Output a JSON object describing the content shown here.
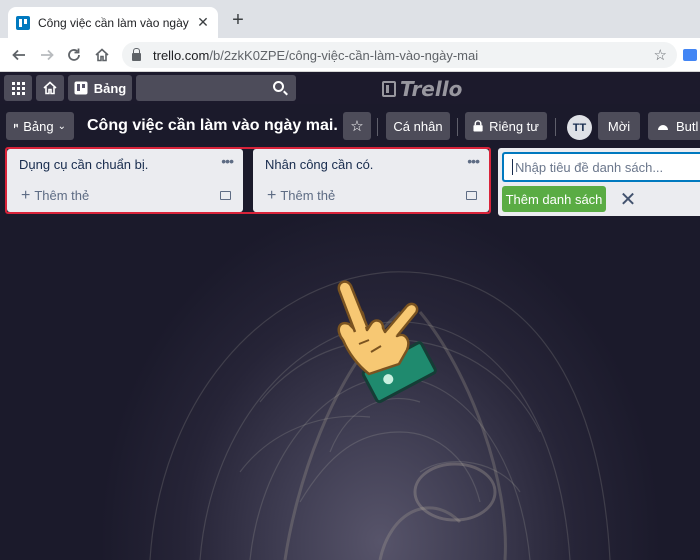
{
  "browser": {
    "tab_title": "Công việc cần làm vào ngày mai.",
    "tab_close": "✕",
    "new_tab": "+",
    "url_host": "trello.com",
    "url_path": "/b/2zkK0ZPE/công-việc-cần-làm-vào-ngày-mai",
    "icons": [
      "trello-favicon",
      "back-icon",
      "forward-icon",
      "reload-icon",
      "home-icon",
      "lock-icon",
      "star-icon",
      "extension-icon"
    ]
  },
  "header": {
    "boards_label": "Bảng",
    "logo_text": "Trello"
  },
  "board": {
    "menu_label": "Bảng",
    "title": "Công việc cần làm vào ngày mai.",
    "team_label": "Cá nhân",
    "visibility_label": "Riêng tư",
    "avatar_initials": "TT",
    "invite_label": "Mời",
    "butler_label": "Butl"
  },
  "lists": [
    {
      "name": "Dụng cụ cần chuẩn bị.",
      "add_card": "Thêm thẻ"
    },
    {
      "name": "Nhân công cần có.",
      "add_card": "Thêm thẻ"
    }
  ],
  "add_list": {
    "placeholder": "Nhập tiêu đề danh sách...",
    "button": "Thêm danh sách",
    "cancel": "✕"
  },
  "colors": {
    "trello_blue": "#0079bf",
    "green_button": "#5aac44",
    "highlight_red": "#d9233a",
    "list_bg": "#ebecf0"
  }
}
